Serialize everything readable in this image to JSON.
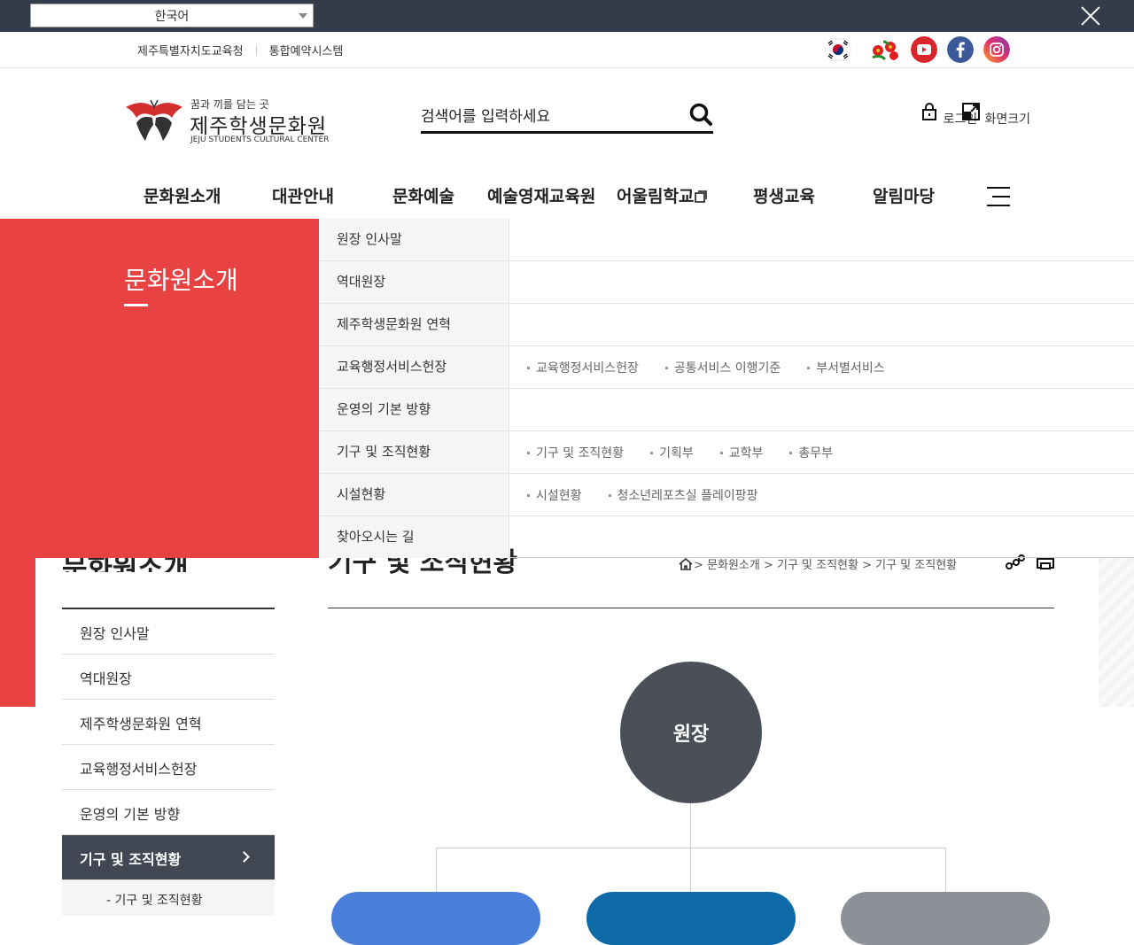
{
  "lang_bar": {
    "language": "한국어"
  },
  "top_links": [
    "제주특별자치도교육청",
    "통합예약시스템"
  ],
  "sns": [
    "korea-flag-icon",
    "camellia-icon",
    "youtube-icon",
    "facebook-icon",
    "instagram-icon"
  ],
  "logo": {
    "slogan": "꿈과 끼를 담는 곳",
    "name": "제주학생문화원",
    "name_en": "JEJU STUDENTS CULTURAL CENTER"
  },
  "search": {
    "placeholder": "검색어를 입력하세요"
  },
  "util": {
    "login": "로그인",
    "zoom": "화면크기"
  },
  "gnb": [
    "문화원소개",
    "대관안내",
    "문화예술",
    "예술영재교육원",
    "어울림학교",
    "평생교육",
    "알림마당"
  ],
  "dropdown": {
    "title": "문화원소개",
    "rows": [
      {
        "label": "원장 인사말",
        "subs": []
      },
      {
        "label": "역대원장",
        "subs": []
      },
      {
        "label": "제주학생문화원 연혁",
        "subs": []
      },
      {
        "label": "교육행정서비스헌장",
        "subs": [
          "교육행정서비스헌장",
          "공통서비스 이행기준",
          "부서별서비스"
        ]
      },
      {
        "label": "운영의 기본 방향",
        "subs": []
      },
      {
        "label": "기구 및 조직현황",
        "subs": [
          "기구 및 조직현황",
          "기획부",
          "교학부",
          "총무부"
        ]
      },
      {
        "label": "시설현황",
        "subs": [
          "시설현황",
          "청소년레포츠실 플레이팡팡"
        ]
      },
      {
        "label": "찾아오시는 길",
        "subs": []
      }
    ]
  },
  "content": {
    "lnb_title": "문화원소개",
    "page_title": "기구 및 조직현황",
    "breadcrumb": "> 문화원소개 > 기구 및 조직현황 > 기구 및 조직현황",
    "lnb": [
      "원장 인사말",
      "역대원장",
      "제주학생문화원 연혁",
      "교육행정서비스헌장",
      "운영의 기본 방향",
      "기구 및 조직현황"
    ],
    "lnb_sub": "- 기구 및 조직현황",
    "org_top": "원장"
  },
  "colors": {
    "accent": "#e84242",
    "dark": "#414854",
    "langbar": "#333c48"
  }
}
